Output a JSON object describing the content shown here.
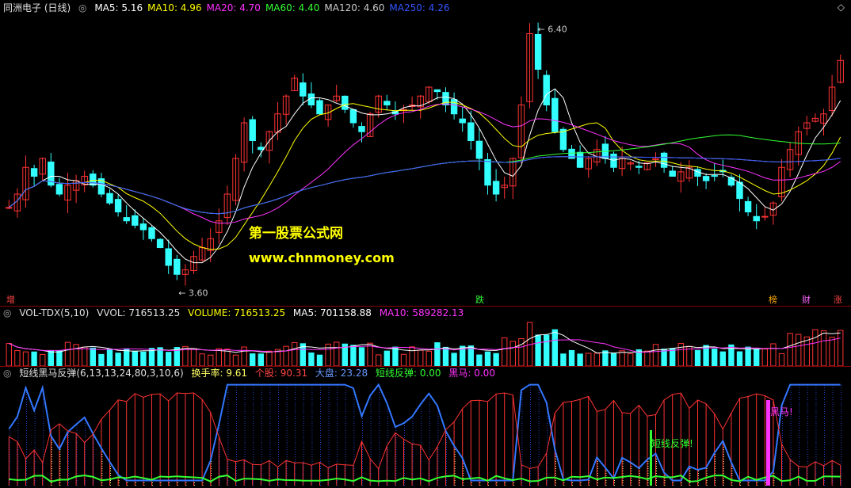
{
  "header": {
    "stock": "同洲电子 (日线)",
    "ma": [
      {
        "label": "MA5: 5.16",
        "color": "#ffffff"
      },
      {
        "label": "MA10: 4.96",
        "color": "#ffff00"
      },
      {
        "label": "MA20: 4.70",
        "color": "#ff33ff"
      },
      {
        "label": "MA60: 4.40",
        "color": "#33ff33"
      },
      {
        "label": "MA120: 4.60",
        "color": "#cccccc"
      },
      {
        "label": "MA250: 4.26",
        "color": "#3355ff"
      }
    ]
  },
  "price": {
    "high_label": "6.40",
    "low_label": "3.60",
    "ylim": [
      3.4,
      6.6
    ],
    "marks": {
      "zeng": "增",
      "die": "跌",
      "bang": "榜",
      "cai": "财",
      "zhang": "涨"
    },
    "watermark1": "第一股票公式网",
    "watermark2": "www.chnmoney.com"
  },
  "vol": {
    "title": "VOL-TDX(5,10)",
    "vvol": "VVOL: 716513.25",
    "volume": "VOLUME: 716513.25",
    "ma5": "MA5: 701158.88",
    "ma10": "MA10: 589282.13"
  },
  "ind": {
    "title": "短线黑马反弹(6,13,13,24,80,3,10,6)",
    "turnover": "换手率: 9.61",
    "stock": "个股: 90.31",
    "market": "大盘: 23.28",
    "rebound": "短线反弹: 0.00",
    "horse": "黑马: 0.00",
    "label_rebound": "短线反弹!",
    "label_horse": "黑马!"
  },
  "chart_data": {
    "type": "candlestick",
    "close_series": [
      4.45,
      4.6,
      4.9,
      4.8,
      5.0,
      4.7,
      4.6,
      4.7,
      4.75,
      4.8,
      4.7,
      4.6,
      4.5,
      4.4,
      4.3,
      4.25,
      4.2,
      4.1,
      4.0,
      3.8,
      3.7,
      3.75,
      3.9,
      4.0,
      4.1,
      4.3,
      4.6,
      5.0,
      5.4,
      5.2,
      5.1,
      5.3,
      5.5,
      5.7,
      5.9,
      5.7,
      5.6,
      5.5,
      5.6,
      5.7,
      5.55,
      5.4,
      5.3,
      5.5,
      5.7,
      5.6,
      5.5,
      5.55,
      5.6,
      5.7,
      5.8,
      5.75,
      5.6,
      5.5,
      5.4,
      5.2,
      5.0,
      4.7,
      4.6,
      4.7,
      5.0,
      5.6,
      6.4,
      6.0,
      5.6,
      5.3,
      5.1,
      5.0,
      4.9,
      5.0,
      5.1,
      5.0,
      4.9,
      5.0,
      4.95,
      4.9,
      4.95,
      5.0,
      4.9,
      4.8,
      4.85,
      4.9,
      4.8,
      4.75,
      4.8,
      4.85,
      4.7,
      4.55,
      4.4,
      4.3,
      4.35,
      4.5,
      4.9,
      5.1,
      5.3,
      5.4,
      5.45,
      5.5,
      5.8,
      6.1
    ],
    "annotations": {
      "high": 6.4,
      "low": 3.6
    }
  }
}
